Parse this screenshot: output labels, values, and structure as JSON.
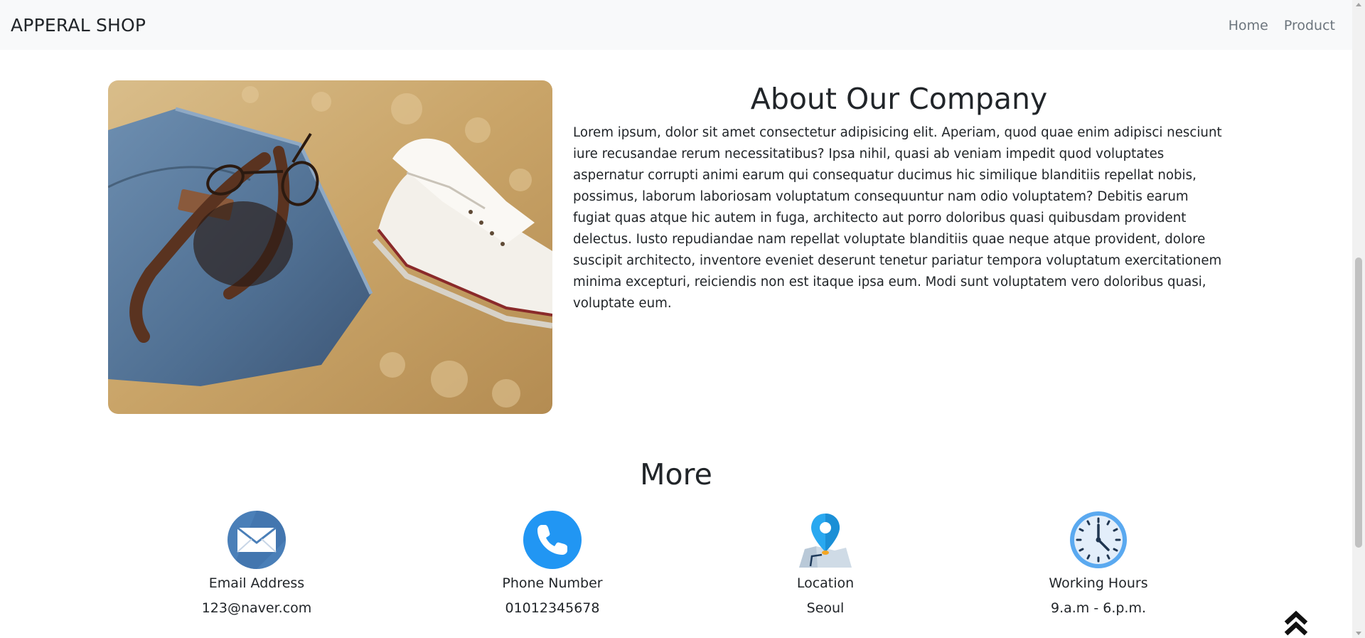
{
  "navbar": {
    "brand": "APPERAL SHOP",
    "links": [
      {
        "label": "Home"
      },
      {
        "label": "Product"
      }
    ]
  },
  "about": {
    "title": "About Our Company",
    "text": "Lorem ipsum, dolor sit amet consectetur adipisicing elit. Aperiam, quod quae enim adipisci nesciunt iure recusandae rerum necessitatibus? Ipsa nihil, quasi ab veniam impedit quod voluptates aspernatur corrupti animi earum qui consequatur ducimus hic similique blanditiis repellat nobis, possimus, laborum laboriosam voluptatum consequuntur nam odio voluptatem? Debitis earum fugiat quas atque hic autem in fuga, architecto aut porro doloribus quasi quibusdam provident delectus. Iusto repudiandae nam repellat voluptate blanditiis quae neque atque provident, dolore suscipit architecto, inventore eveniet deserunt tenetur pariatur tempora voluptatum exercitationem minima excepturi, reiciendis non est itaque ipsa eum. Modi sunt voluptatem vero doloribus quasi, voluptate eum."
  },
  "more": {
    "title": "More",
    "items": [
      {
        "icon": "envelope-icon",
        "label": "Email Address",
        "value": "123@naver.com"
      },
      {
        "icon": "phone-icon",
        "label": "Phone Number",
        "value": "01012345678"
      },
      {
        "icon": "map-pin-icon",
        "label": "Location",
        "value": "Seoul"
      },
      {
        "icon": "clock-icon",
        "label": "Working Hours",
        "value": "9.a.m - 6.p.m."
      }
    ]
  },
  "colors": {
    "navbar_bg": "#f8f9fa",
    "link": "#6c757d",
    "icon_blue": "#2196f3",
    "email_blue": "#4a7fb8"
  }
}
